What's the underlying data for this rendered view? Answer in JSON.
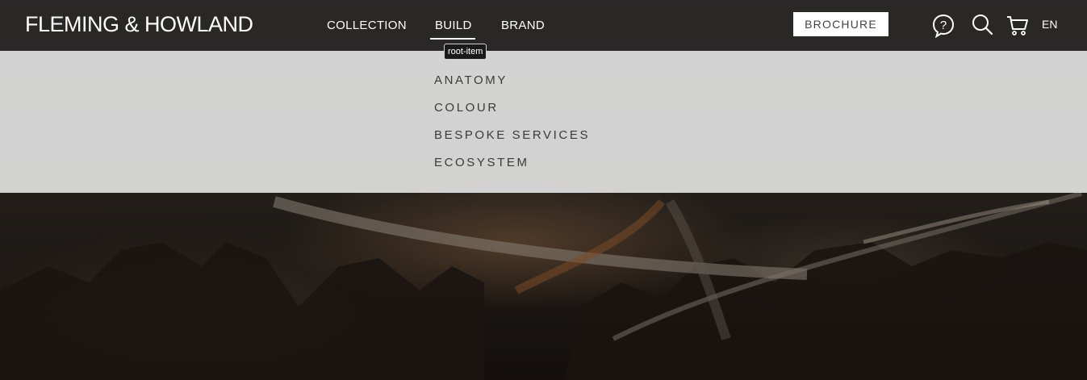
{
  "header": {
    "logo_text": "FLEMING & HOWLAND",
    "nav": [
      {
        "label": "COLLECTION"
      },
      {
        "label": "BUILD"
      },
      {
        "label": "BRAND"
      }
    ],
    "tooltip": "root-item",
    "brochure_label": "BROCHURE",
    "icons": [
      "help-icon",
      "search-icon",
      "cart-icon"
    ],
    "language": "EN"
  },
  "dropdown": {
    "items": [
      {
        "label": "ANATOMY"
      },
      {
        "label": "COLOUR"
      },
      {
        "label": "BESPOKE SERVICES"
      },
      {
        "label": "ECOSYSTEM"
      }
    ]
  },
  "colors": {
    "topbar": "#2a2828",
    "dropdown": "#e6e5e5",
    "dropdown_text": "#3a3a3a",
    "brochure_bg": "#ffffff"
  }
}
